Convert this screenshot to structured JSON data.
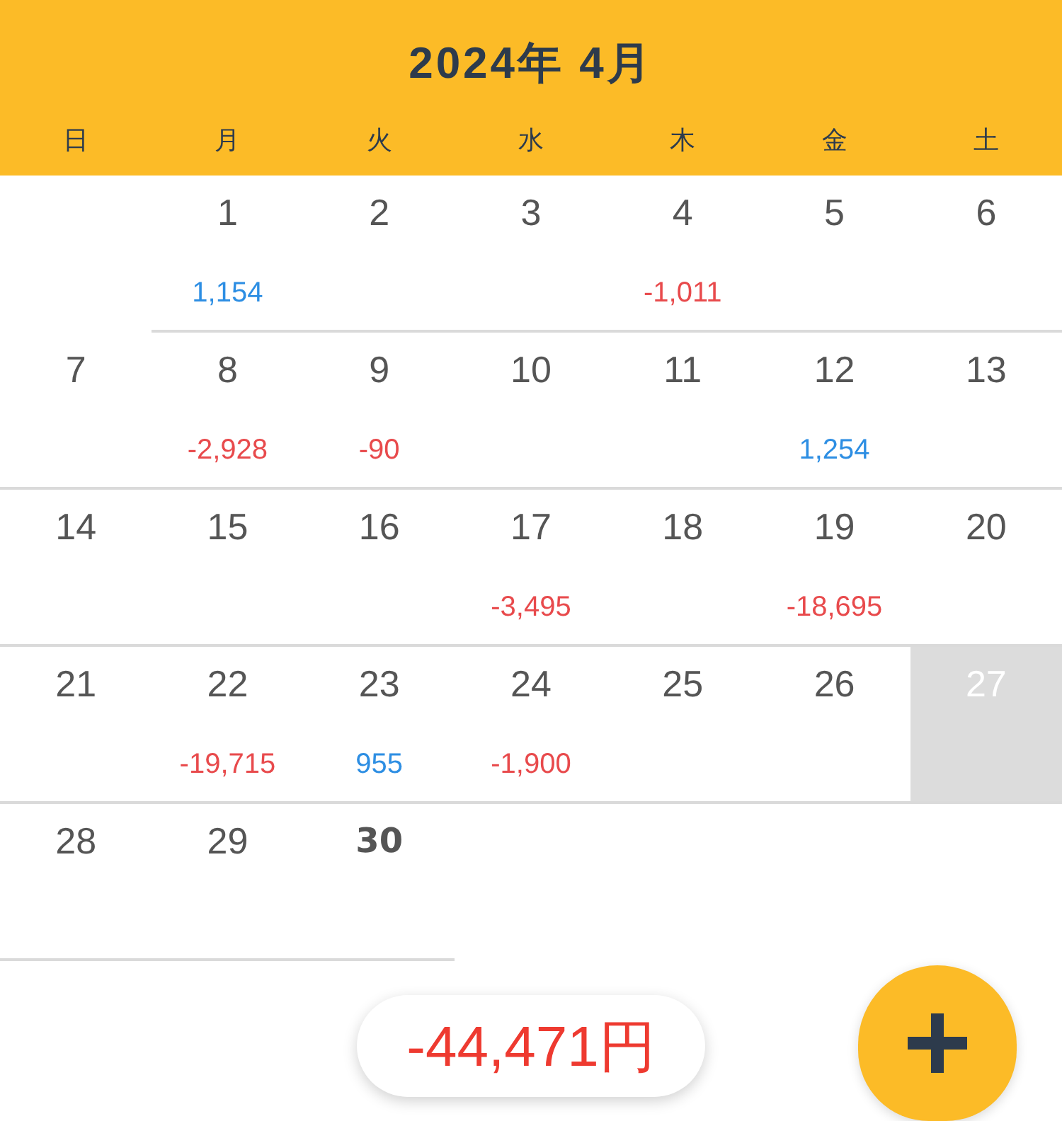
{
  "header": {
    "title": "2024年 4月",
    "weekdays": [
      "日",
      "月",
      "火",
      "水",
      "木",
      "金",
      "土"
    ]
  },
  "weeks": [
    {
      "days": [
        {
          "kind": "blank"
        },
        {
          "kind": "day",
          "day": "1",
          "amount": {
            "text": "1,154",
            "color": "#2d8ee3"
          },
          "selected": false,
          "today": false
        },
        {
          "kind": "day",
          "day": "2",
          "selected": false,
          "today": false
        },
        {
          "kind": "day",
          "day": "3",
          "selected": false,
          "today": false
        },
        {
          "kind": "day",
          "day": "4",
          "amount": {
            "text": "-1,011",
            "color": "#e84a4c"
          },
          "selected": false,
          "today": false
        },
        {
          "kind": "day",
          "day": "5",
          "selected": false,
          "today": false
        },
        {
          "kind": "day",
          "day": "6",
          "selected": false,
          "today": false
        }
      ]
    },
    {
      "days": [
        {
          "kind": "day",
          "day": "7",
          "selected": false,
          "today": false
        },
        {
          "kind": "day",
          "day": "8",
          "amount": {
            "text": "-2,928",
            "color": "#e84a4c"
          },
          "selected": false,
          "today": false
        },
        {
          "kind": "day",
          "day": "9",
          "amount": {
            "text": "-90",
            "color": "#e84a4c"
          },
          "selected": false,
          "today": false
        },
        {
          "kind": "day",
          "day": "10",
          "selected": false,
          "today": false
        },
        {
          "kind": "day",
          "day": "11",
          "selected": false,
          "today": false
        },
        {
          "kind": "day",
          "day": "12",
          "amount": {
            "text": "1,254",
            "color": "#2d8ee3"
          },
          "selected": false,
          "today": false
        },
        {
          "kind": "day",
          "day": "13",
          "selected": false,
          "today": false
        }
      ]
    },
    {
      "days": [
        {
          "kind": "day",
          "day": "14",
          "selected": false,
          "today": false
        },
        {
          "kind": "day",
          "day": "15",
          "selected": false,
          "today": false
        },
        {
          "kind": "day",
          "day": "16",
          "selected": false,
          "today": false
        },
        {
          "kind": "day",
          "day": "17",
          "amount": {
            "text": "-3,495",
            "color": "#e84a4c"
          },
          "selected": false,
          "today": false
        },
        {
          "kind": "day",
          "day": "18",
          "selected": false,
          "today": false
        },
        {
          "kind": "day",
          "day": "19",
          "amount": {
            "text": "-18,695",
            "color": "#e84a4c"
          },
          "selected": false,
          "today": false
        },
        {
          "kind": "day",
          "day": "20",
          "selected": false,
          "today": false
        }
      ]
    },
    {
      "days": [
        {
          "kind": "day",
          "day": "21",
          "selected": false,
          "today": false
        },
        {
          "kind": "day",
          "day": "22",
          "amount": {
            "text": "-19,715",
            "color": "#e84a4c"
          },
          "selected": false,
          "today": false
        },
        {
          "kind": "day",
          "day": "23",
          "amount": {
            "text": "955",
            "color": "#2d8ee3"
          },
          "selected": false,
          "today": false
        },
        {
          "kind": "day",
          "day": "24",
          "amount": {
            "text": "-1,900",
            "color": "#e84a4c"
          },
          "selected": false,
          "today": false
        },
        {
          "kind": "day",
          "day": "25",
          "selected": false,
          "today": false
        },
        {
          "kind": "day",
          "day": "26",
          "selected": false,
          "today": false
        },
        {
          "kind": "day",
          "day": "27",
          "selected": true,
          "today": false
        }
      ]
    },
    {
      "days": [
        {
          "kind": "day",
          "day": "28",
          "selected": false,
          "today": false
        },
        {
          "kind": "day",
          "day": "29",
          "selected": false,
          "today": false
        },
        {
          "kind": "day",
          "day": "30",
          "selected": false,
          "today": true
        },
        {
          "kind": "blank"
        },
        {
          "kind": "blank"
        },
        {
          "kind": "blank"
        },
        {
          "kind": "blank"
        }
      ]
    }
  ],
  "total": {
    "text": "-44,471円",
    "color": "#ee3a30"
  }
}
